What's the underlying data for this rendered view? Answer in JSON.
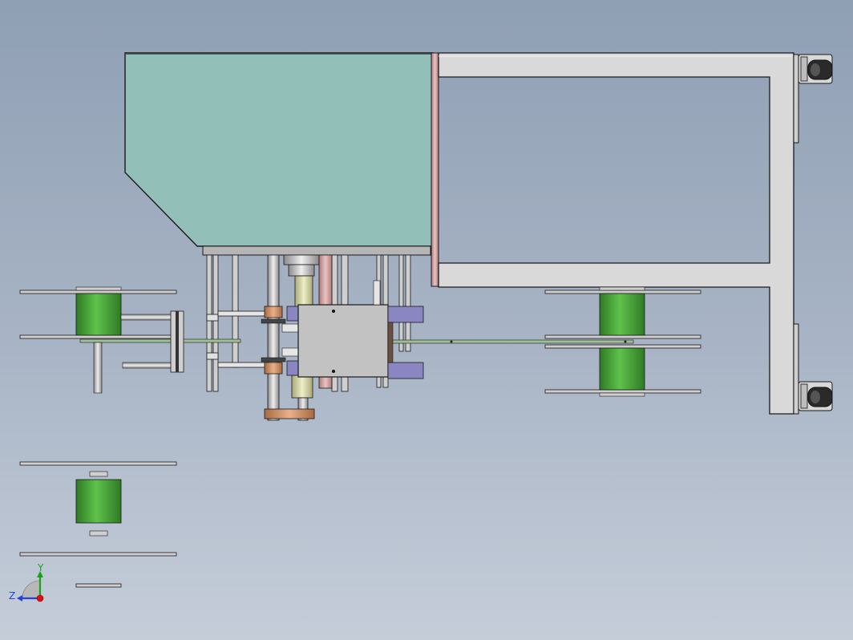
{
  "viewport": {
    "background_top": "#8f9fb4",
    "background_bottom": "#c5cdd9"
  },
  "colors": {
    "hopper_fill": "#92bfb8",
    "frame_fill": "#d9d9d9",
    "edge": "#1a1a1a",
    "roll_green": "#4fb33f",
    "copper": "#cf8f63",
    "slider_purple": "#8a86c2",
    "carriage_gray": "#c2c2c2",
    "cream_roller": "#d8d8a8",
    "pink_plate": "#c79a9a"
  },
  "triad": {
    "y_label": "Y",
    "z_label": "Z",
    "y_color": "#16a316",
    "z_color": "#2244dd",
    "x_color": "#dd1111"
  }
}
